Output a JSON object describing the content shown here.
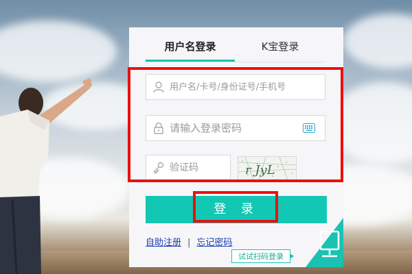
{
  "tabs": {
    "account_label": "用户名登录",
    "kbao_label": "K宝登录"
  },
  "form": {
    "username_placeholder": "用户名/卡号/身份证号/手机号",
    "password_placeholder": "请输入登录密码",
    "captcha_placeholder": "验证码",
    "captcha_image_text": "r JyL"
  },
  "login_button": "登 录",
  "links": {
    "register": "自助注册",
    "forgot": "忘记密码"
  },
  "qr_tip": "试试扫码登录",
  "colors": {
    "accent": "#12c8b4",
    "highlight_box": "#ea1010",
    "link": "#1a3fb0"
  },
  "icons": [
    "user-icon",
    "lock-icon",
    "keyboard-icon",
    "key-icon",
    "qr-monitor-icon"
  ]
}
